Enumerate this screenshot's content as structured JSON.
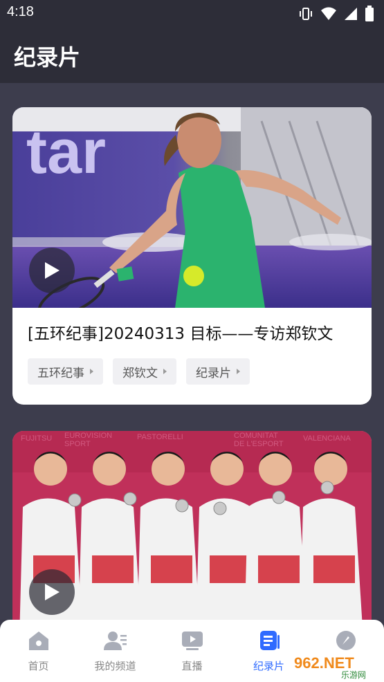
{
  "status_bar": {
    "time": "4:18"
  },
  "header": {
    "title": "纪录片"
  },
  "cards": [
    {
      "title": "[五环纪事]20240313 目标——专访郑钦文",
      "tags": [
        "五环纪事",
        "郑钦文",
        "纪录片"
      ]
    },
    {
      "title": "",
      "tags": []
    }
  ],
  "bottom_nav": {
    "items": [
      {
        "label": "首页",
        "icon": "home-icon"
      },
      {
        "label": "我的频道",
        "icon": "my-channel-icon"
      },
      {
        "label": "直播",
        "icon": "live-icon"
      },
      {
        "label": "纪录片",
        "icon": "documentary-icon"
      },
      {
        "label": "",
        "icon": "rocket-icon"
      }
    ],
    "active_index": 3
  },
  "watermark": {
    "text_top": "962.NET",
    "text_bottom": "乐游网"
  },
  "colors": {
    "accent": "#2f6bff",
    "header_bg": "#2d2d38",
    "content_bg": "#3d3d4d"
  }
}
